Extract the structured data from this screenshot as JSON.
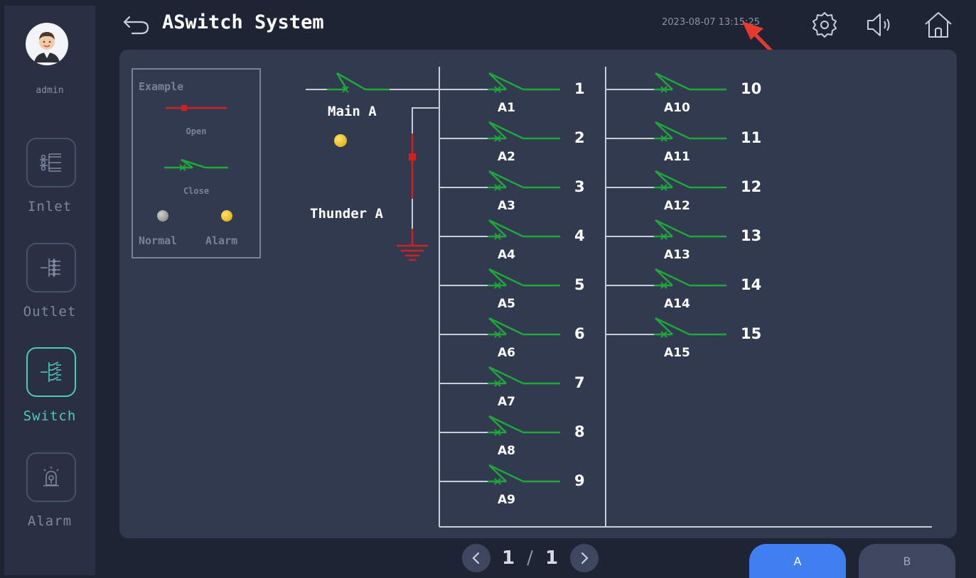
{
  "header": {
    "title": "ASwitch System",
    "datetime": "2023-08-07 13:15:25"
  },
  "user": {
    "name": "admin"
  },
  "nav": {
    "items": [
      {
        "label": "Inlet",
        "icon": "inlet-icon",
        "active": false
      },
      {
        "label": "Outlet",
        "icon": "outlet-icon",
        "active": false
      },
      {
        "label": "Switch",
        "icon": "switch-icon",
        "active": true
      },
      {
        "label": "Alarm",
        "icon": "alarm-icon",
        "active": false
      }
    ]
  },
  "legend": {
    "title": "Example",
    "open": "Open",
    "close": "Close",
    "normal": "Normal",
    "alarm": "Alarm"
  },
  "main": {
    "main_label": "Main A",
    "thunder_label": "Thunder A",
    "main_status": "alarm"
  },
  "branches": [
    {
      "num": "1",
      "label": "A1",
      "state": "close"
    },
    {
      "num": "2",
      "label": "A2",
      "state": "close"
    },
    {
      "num": "3",
      "label": "A3",
      "state": "close"
    },
    {
      "num": "4",
      "label": "A4",
      "state": "close"
    },
    {
      "num": "5",
      "label": "A5",
      "state": "close"
    },
    {
      "num": "6",
      "label": "A6",
      "state": "close"
    },
    {
      "num": "7",
      "label": "A7",
      "state": "close"
    },
    {
      "num": "8",
      "label": "A8",
      "state": "close"
    },
    {
      "num": "9",
      "label": "A9",
      "state": "close"
    },
    {
      "num": "10",
      "label": "A10",
      "state": "close"
    },
    {
      "num": "11",
      "label": "A11",
      "state": "close"
    },
    {
      "num": "12",
      "label": "A12",
      "state": "close"
    },
    {
      "num": "13",
      "label": "A13",
      "state": "close"
    },
    {
      "num": "14",
      "label": "A14",
      "state": "close"
    },
    {
      "num": "15",
      "label": "A15",
      "state": "close"
    }
  ],
  "pagination": {
    "current": "1",
    "separator": "/",
    "total": "1"
  },
  "tabs": {
    "a": "A",
    "b": "B",
    "active": "A"
  },
  "colors": {
    "accent": "#4fc8c0",
    "switch_closed": "#1fa83a",
    "switch_open": "#d21f1f",
    "alarm_led": "#f2c21b",
    "normal_led": "#9a9a9a",
    "active_tab": "#3f7ff0"
  }
}
